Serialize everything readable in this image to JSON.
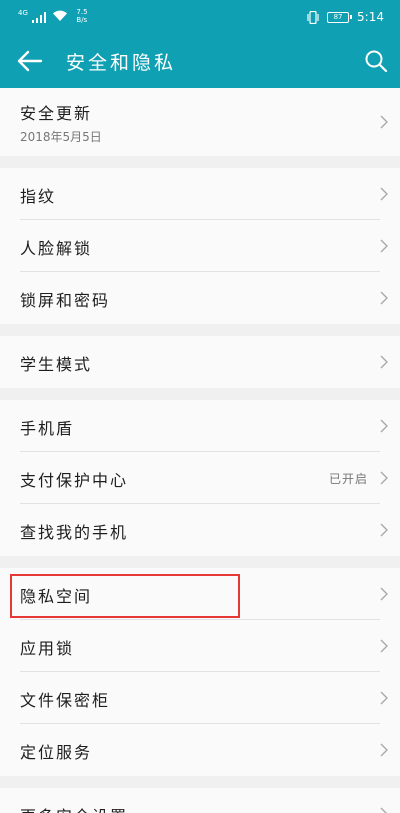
{
  "status_bar": {
    "network": "4G",
    "speed_value": "7.5",
    "speed_unit": "B/s",
    "battery": "87",
    "time": "5:14"
  },
  "header": {
    "title": "安全和隐私",
    "icons": [
      "back-arrow-icon",
      "search-icon"
    ],
    "color": "#10a0b3"
  },
  "groups": [
    {
      "items": [
        {
          "label": "安全更新",
          "subtitle": "2018年5月5日"
        }
      ]
    },
    {
      "items": [
        {
          "label": "指纹"
        },
        {
          "label": "人脸解锁"
        },
        {
          "label": "锁屏和密码"
        }
      ]
    },
    {
      "items": [
        {
          "label": "学生模式"
        }
      ]
    },
    {
      "items": [
        {
          "label": "手机盾"
        },
        {
          "label": "支付保护中心",
          "value": "已开启"
        },
        {
          "label": "查找我的手机"
        }
      ]
    },
    {
      "items": [
        {
          "label": "隐私空间"
        },
        {
          "label": "应用锁"
        },
        {
          "label": "文件保密柜"
        },
        {
          "label": "定位服务"
        }
      ]
    },
    {
      "items": [
        {
          "label": "更多安全设置"
        }
      ]
    }
  ],
  "highlight_color": "#e53935"
}
